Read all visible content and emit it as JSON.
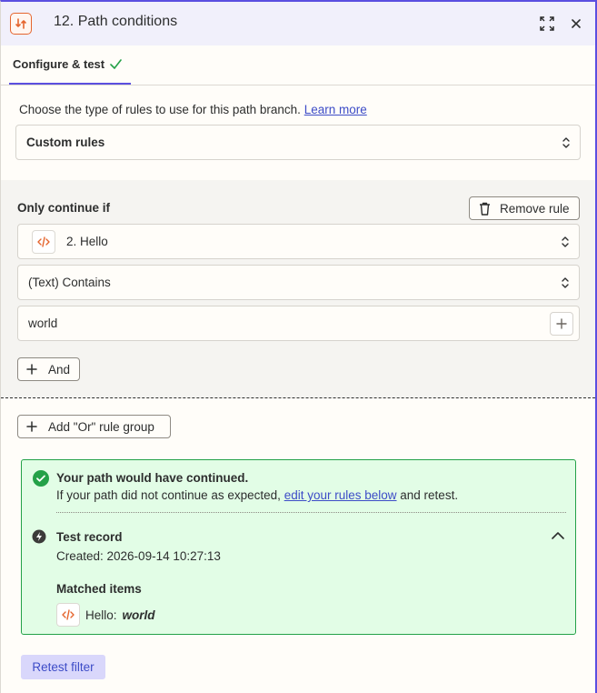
{
  "header": {
    "title": "12. Path conditions",
    "icon": "path-branch-icon",
    "accent_color": "#e5652e"
  },
  "tabs": [
    {
      "label": "Configure & test",
      "status_icon": "check-icon",
      "active": true
    }
  ],
  "rule_type": {
    "prompt": "Choose the type of rules to use for this path branch.",
    "learn_more": "Learn more",
    "selected": "Custom rules"
  },
  "rules": {
    "heading": "Only continue if",
    "remove_label": "Remove rule",
    "field": "2. Hello",
    "condition": "(Text) Contains",
    "value": "world",
    "and_label": "And",
    "or_label": "Add \"Or\" rule group"
  },
  "result": {
    "title": "Your path would have continued.",
    "sub_prefix": "If your path did not continue as expected,",
    "sub_link": "edit your rules below",
    "sub_suffix": "and retest.",
    "record_title": "Test record",
    "created": "Created: 2026-09-14 10:27:13",
    "matched_title": "Matched items",
    "matched_key": "Hello:",
    "matched_value": "world",
    "success_color": "#24a148"
  },
  "retest_label": "Retest filter",
  "primary_color": "#5b4fe0"
}
